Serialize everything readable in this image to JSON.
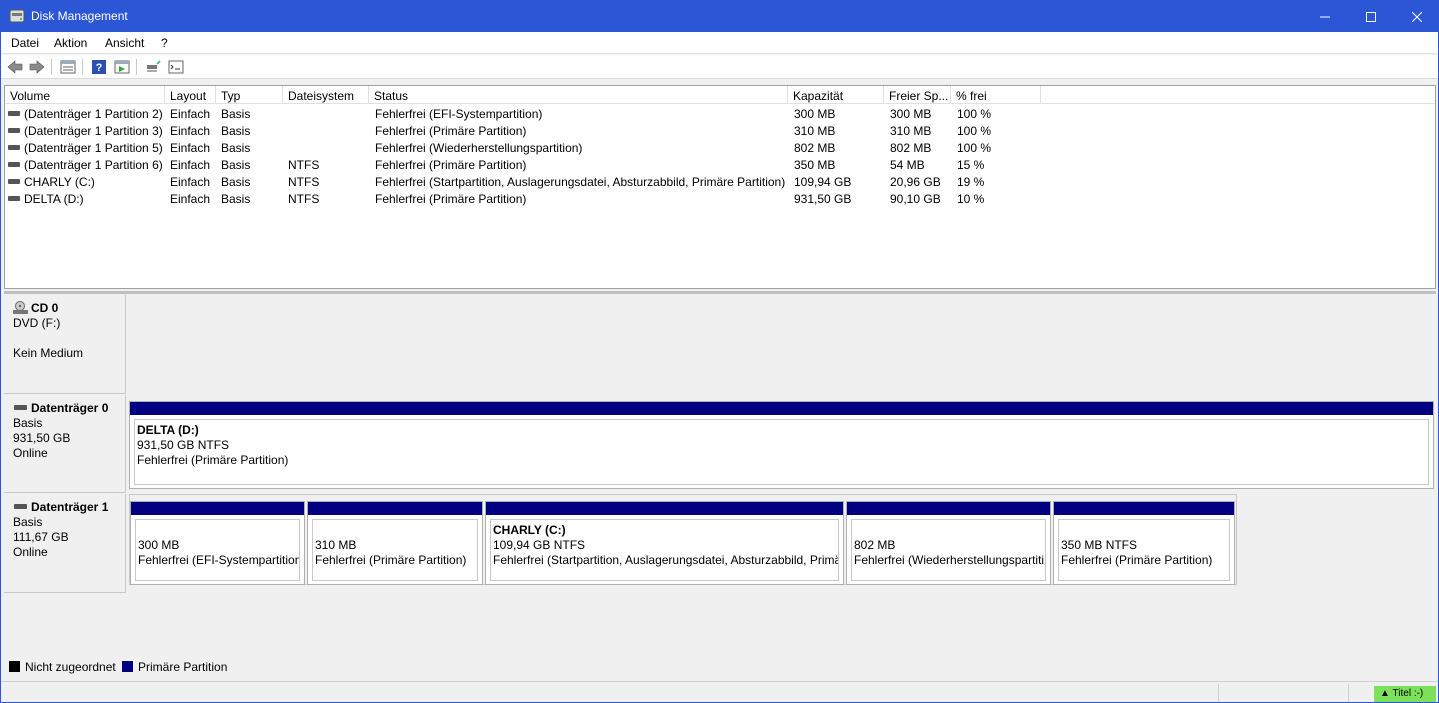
{
  "window": {
    "title": "Disk Management"
  },
  "menu": [
    "Datei",
    "Aktion",
    "Ansicht",
    "?"
  ],
  "toolbar": [
    "back-arrow-icon",
    "forward-arrow-icon",
    "list-view-icon",
    "help-icon",
    "properties-view-icon",
    "rescan-icon",
    "console-icon"
  ],
  "volumes": {
    "columns": [
      "Volume",
      "Layout",
      "Typ",
      "Dateisystem",
      "Status",
      "Kapazität",
      "Freier Sp...",
      "% frei"
    ],
    "rows": [
      [
        "(Datenträger 1 Partition 2)",
        "Einfach",
        "Basis",
        "",
        "Fehlerfrei (EFI-Systempartition)",
        "300 MB",
        "300 MB",
        "100 %"
      ],
      [
        "(Datenträger 1 Partition 3)",
        "Einfach",
        "Basis",
        "",
        "Fehlerfrei (Primäre Partition)",
        "310 MB",
        "310 MB",
        "100 %"
      ],
      [
        "(Datenträger 1 Partition 5)",
        "Einfach",
        "Basis",
        "",
        "Fehlerfrei (Wiederherstellungspartition)",
        "802 MB",
        "802 MB",
        "100 %"
      ],
      [
        "(Datenträger 1 Partition 6)",
        "Einfach",
        "Basis",
        "NTFS",
        "Fehlerfrei (Primäre Partition)",
        "350 MB",
        "54 MB",
        "15 %"
      ],
      [
        "CHARLY (C:)",
        "Einfach",
        "Basis",
        "NTFS",
        "Fehlerfrei (Startpartition, Auslagerungsdatei, Absturzabbild, Primäre Partition)",
        "109,94 GB",
        "20,96 GB",
        "19 %"
      ],
      [
        "DELTA (D:)",
        "Einfach",
        "Basis",
        "NTFS",
        "Fehlerfrei (Primäre Partition)",
        "931,50 GB",
        "90,10 GB",
        "10 %"
      ]
    ]
  },
  "disks": {
    "cd0": {
      "name": "CD 0",
      "line1": "DVD (F:)",
      "line3": "Kein Medium"
    },
    "disk0": {
      "name": "Datenträger 0",
      "type": "Basis",
      "size": "931,50 GB",
      "state": "Online",
      "parts": [
        {
          "name": "DELTA  (D:)",
          "size": "931,50 GB NTFS",
          "status": "Fehlerfrei (Primäre Partition)"
        }
      ]
    },
    "disk1": {
      "name": "Datenträger 1",
      "type": "Basis",
      "size": "111,67 GB",
      "state": "Online",
      "parts": [
        {
          "name": "",
          "size": "300 MB",
          "status": "Fehlerfrei (EFI-Systempartition)"
        },
        {
          "name": "",
          "size": "310 MB",
          "status": "Fehlerfrei (Primäre Partition)"
        },
        {
          "name": "CHARLY  (C:)",
          "size": "109,94 GB NTFS",
          "status": "Fehlerfrei (Startpartition, Auslagerungsdatei, Absturzabbild, Primä"
        },
        {
          "name": "",
          "size": "802 MB",
          "status": "Fehlerfrei (Wiederherstellungspartiti"
        },
        {
          "name": "",
          "size": "350 MB NTFS",
          "status": "Fehlerfrei (Primäre Partition)"
        }
      ]
    }
  },
  "legend": [
    {
      "label": "Nicht zugeordnet",
      "color": "#000000"
    },
    {
      "label": "Primäre Partition",
      "color": "#000080"
    }
  ],
  "statusbar": {
    "badge": "Titel :-)"
  },
  "colors": {
    "titlebar": "#2b56d6",
    "primary_partition": "#000080",
    "badge": "#7ce05a"
  }
}
